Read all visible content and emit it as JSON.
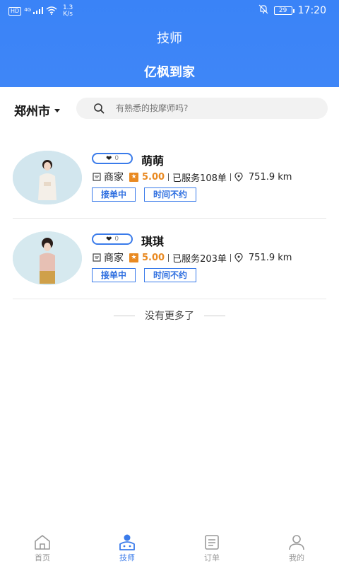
{
  "status_bar": {
    "hd_badge": "HD",
    "network": "4G",
    "speed_value": "1.3",
    "speed_unit": "K/s",
    "battery": "29",
    "time": "17:20"
  },
  "header": {
    "title": "技师",
    "brand": "亿枫到家"
  },
  "filter": {
    "city": "郑州市",
    "search_placeholder": "有熟悉的按摩师吗?"
  },
  "technicians": [
    {
      "likes": "0",
      "name": "萌萌",
      "shop_label": "商家",
      "rating": "5.00",
      "served": "已服务108单",
      "distance": "751.9 km",
      "tag1": "接单中",
      "tag2": "时间不约"
    },
    {
      "likes": "0",
      "name": "琪琪",
      "shop_label": "商家",
      "rating": "5.00",
      "served": "已服务203单",
      "distance": "751.9 km",
      "tag1": "接单中",
      "tag2": "时间不约"
    }
  ],
  "list_footer": "没有更多了",
  "tabbar": {
    "home": "首页",
    "tech": "技师",
    "orders": "订单",
    "mine": "我的"
  },
  "colors": {
    "primary": "#3a83f7",
    "accent_orange": "#e98a22",
    "tag_blue": "#2f6fe0"
  }
}
